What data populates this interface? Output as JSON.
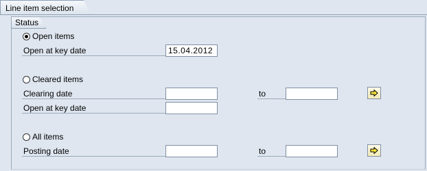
{
  "tab": {
    "label": "Line item selection"
  },
  "group": {
    "title": "Status"
  },
  "open_items": {
    "radio_label": "Open items",
    "key_date_label": "Open at key date",
    "key_date_value": "15.04.2012"
  },
  "cleared_items": {
    "radio_label": "Cleared items",
    "clearing_date_label": "Clearing date",
    "to_label": "to",
    "key_date_label": "Open at key date"
  },
  "all_items": {
    "radio_label": "All items",
    "posting_date_label": "Posting date",
    "to_label": "to"
  },
  "icons": {
    "multiple_selection": "arrow-right-icon"
  }
}
